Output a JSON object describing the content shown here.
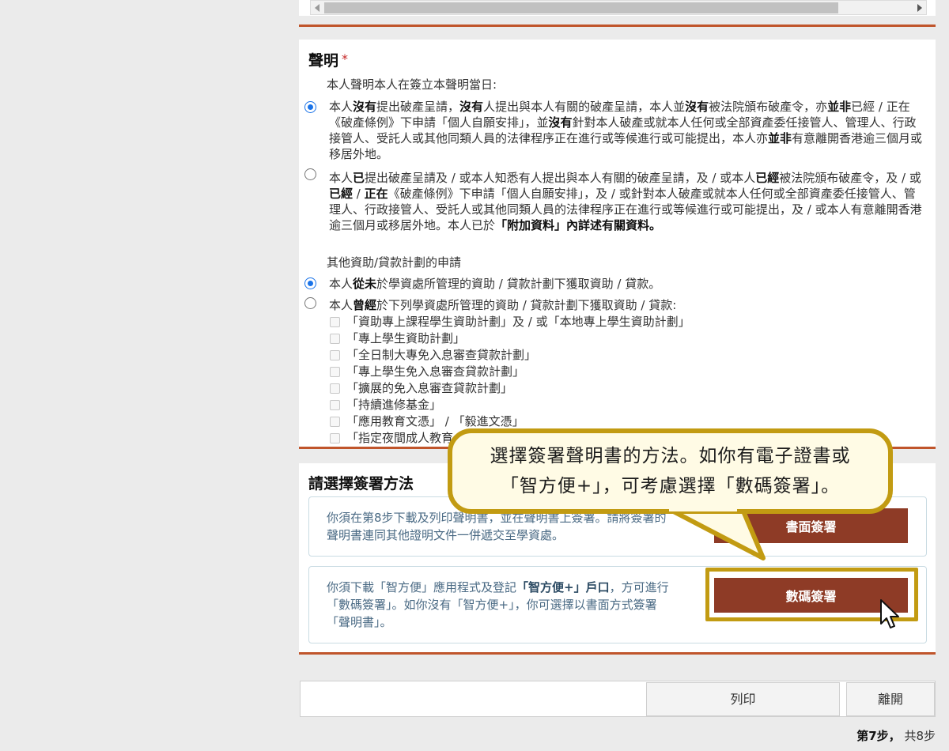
{
  "declaration": {
    "title": "聲明",
    "required_mark": "*",
    "intro": "本人聲明本人在簽立本聲明當日:",
    "option1_html": "本人<b>沒有</b>提出破產呈請，<b>沒有</b>人提出與本人有關的破產呈請，本人並<b>沒有</b>被法院頒布破產令，亦<b>並非</b>已經 / 正在《破產條例》下申請「個人自願安排」，並<b>沒有</b>針對本人破產或就本人任何或全部資產委任接管人、管理人、行政接管人、受託人或其他同類人員的法律程序正在進行或等候進行或可能提出，本人亦<b>並非</b>有意離開香港逾三個月或移居外地。",
    "option2_html": "本人<b>已</b>提出破產呈請及 / 或本人知悉有人提出與本人有關的破產呈請，及 / 或本人<b>已經</b>被法院頒布破產令，及 / 或<b>已經</b> / <b>正在</b>《破產條例》下申請「個人自願安排」，及 / 或針對本人破產或就本人任何或全部資產委任接管人、管理人、行政接管人、受託人或其他同類人員的法律程序正在進行或等候進行或可能提出，及 / 或本人有意離開香港逾三個月或移居外地。本人已於<b>「附加資料」內詳述有關資料。</b>",
    "option1_selected": true
  },
  "other_schemes": {
    "heading": "其他資助/貸款計劃的申請",
    "never_html": "本人<b>從未</b>於學資處所管理的資助 / 貸款計劃下獲取資助 / 貸款。",
    "have_html": "本人<b>曾經</b>於下列學資處所管理的資助 / 貸款計劃下獲取資助 / 貸款:",
    "schemes": [
      "「資助專上課程學生資助計劃」及 / 或「本地專上學生資助計劃」",
      "「專上學生資助計劃」",
      "「全日制大專免入息審查貸款計劃」",
      "「專上學生免入息審查貸款計劃」",
      "「擴展的免入息審查貸款計劃」",
      "「持續進修基金」",
      "「應用教育文憑」 / 「毅進文憑」",
      "「指定夜間成人教育"
    ]
  },
  "signing": {
    "title": "請選擇簽署方法",
    "paper_text": "你須在第8步下載及列印聲明書，並在聲明書上簽署。請將簽署的聲明書連同其他證明文件一併遞交至學資處。",
    "paper_button": "書面簽署",
    "digital_text_html": "你須下載「智方便」應用程式及登記<b>「智方便+」戶口</b>，方可進行「數碼簽署」。如你沒有「智方便+」，你可選擇以書面方式簽署「聲明書」。",
    "digital_button": "數碼簽署"
  },
  "callout": {
    "line1": "選擇簽署聲明書的方法。如你有電子證書或",
    "line2": "「智方便+」，可考慮選擇「數碼簽署」。"
  },
  "footer": {
    "print_label": "列印",
    "exit_label": "離開",
    "step_bold": "第7步，",
    "step_rest": " 共8步"
  },
  "colors": {
    "accent_rule": "#c0552b",
    "button_brown": "#8e3b26",
    "highlight_gold": "#c29b12",
    "radio_blue": "#1a73e8"
  }
}
